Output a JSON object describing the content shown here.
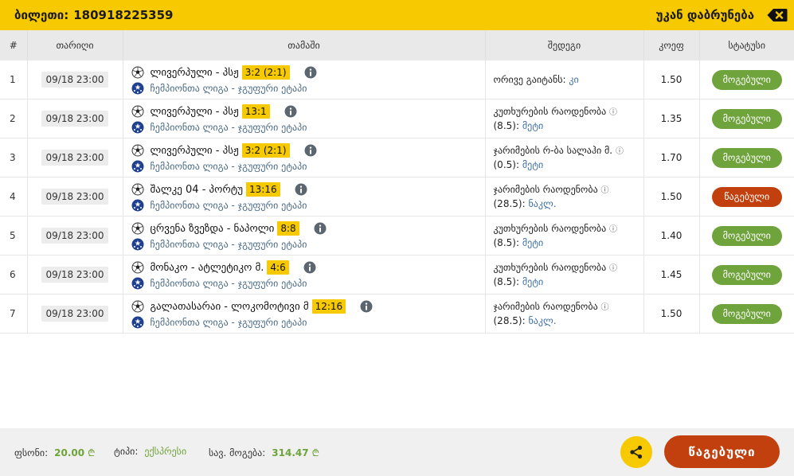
{
  "header": {
    "ticket_label": "ბილეთი:",
    "ticket_id": "180918225359",
    "back_label": "უკან დაბრუნება"
  },
  "columns": {
    "num": "#",
    "date": "თარიღი",
    "game": "თამაში",
    "result": "შედეგი",
    "odds": "კოეფ",
    "status": "სტატუსი"
  },
  "rows": [
    {
      "num": "1",
      "date": "09/18 23:00",
      "match": "ლივერპული - პსჟ",
      "score": "3:2 (2:1)",
      "league": "ჩემპიონთა ლიგა - ჯგუფური ეტაპი",
      "result_text": "ორივე გაიტანს:",
      "result_extra": "",
      "result_value": "კი",
      "odds": "1.50",
      "status": "მოგებული",
      "status_type": "win"
    },
    {
      "num": "2",
      "date": "09/18 23:00",
      "match": "ლივერპული - პსჟ",
      "score": "13:1",
      "league": "ჩემპიონთა ლიგა - ჯგუფური ეტაპი",
      "result_text": "კუთხურების რაოდენობა",
      "result_extra": "(8.5):",
      "result_value": "მეტი",
      "odds": "1.35",
      "status": "მოგებული",
      "status_type": "win"
    },
    {
      "num": "3",
      "date": "09/18 23:00",
      "match": "ლივერპული - პსჟ",
      "score": "3:2 (2:1)",
      "league": "ჩემპიონთა ლიგა - ჯგუფური ეტაპი",
      "result_text": "ჯარიმების რ-ბა სალაჰი მ.",
      "result_extra": "(0.5):",
      "result_value": "მეტი",
      "odds": "1.70",
      "status": "მოგებული",
      "status_type": "win"
    },
    {
      "num": "4",
      "date": "09/18 23:00",
      "match": "შალკე 04 - პორტუ",
      "score": "13:16",
      "league": "ჩემპიონთა ლიგა - ჯგუფური ეტაპი",
      "result_text": "ჯარიმების რაოდენობა",
      "result_extra": "(28.5):",
      "result_value": "ნაკლ.",
      "odds": "1.50",
      "status": "წაგებული",
      "status_type": "lose"
    },
    {
      "num": "5",
      "date": "09/18 23:00",
      "match": "ცრვენა ზვეზდა - ნაპოლი",
      "score": "8:8",
      "league": "ჩემპიონთა ლიგა - ჯგუფური ეტაპი",
      "result_text": "კუთხურების რაოდენობა",
      "result_extra": "(8.5):",
      "result_value": "მეტი",
      "odds": "1.40",
      "status": "მოგებული",
      "status_type": "win"
    },
    {
      "num": "6",
      "date": "09/18 23:00",
      "match": "მონაკო - ატლეტიკო მ.",
      "score": "4:6",
      "league": "ჩემპიონთა ლიგა - ჯგუფური ეტაპი",
      "result_text": "კუთხურების რაოდენობა",
      "result_extra": "(8.5):",
      "result_value": "მეტი",
      "odds": "1.45",
      "status": "მოგებული",
      "status_type": "win"
    },
    {
      "num": "7",
      "date": "09/18 23:00",
      "match": "გალათასარაი - ლოკომოტივი მ",
      "score": "12:16",
      "league": "ჩემპიონთა ლიგა - ჯგუფური ეტაპი",
      "result_text": "ჯარიმების რაოდენობა",
      "result_extra": "(28.5):",
      "result_value": "ნაკლ.",
      "odds": "1.50",
      "status": "მოგებული",
      "status_type": "win"
    }
  ],
  "footer": {
    "stake_label": "ფსონი:",
    "stake_value": "20.00",
    "type_label": "ტიპი:",
    "type_value": "ექსპრესი",
    "possible_win_label": "სავ. მოგება:",
    "possible_win_value": "314.47",
    "currency_symbol": "₾",
    "lost_button": "წაგებული"
  },
  "colors": {
    "accent": "#f7c900",
    "win": "#6fa33b",
    "lose": "#c1400e"
  },
  "icons": {
    "back": "backspace-icon",
    "ball": "soccer-ball-icon",
    "league": "champions-league-icon",
    "info": "info-icon",
    "share": "share-icon",
    "result_info": "info-small-icon"
  }
}
